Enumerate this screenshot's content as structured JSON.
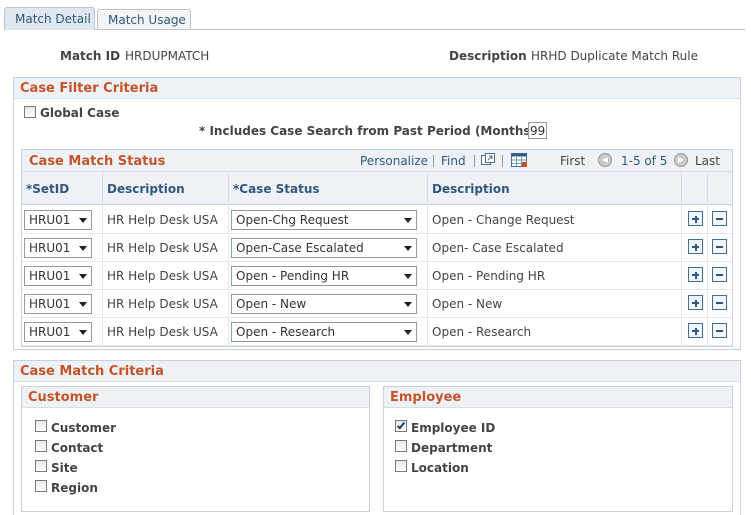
{
  "tabs": [
    {
      "label": "Match Detail"
    },
    {
      "label": "Match Usage"
    }
  ],
  "header": {
    "match_id_label": "Match ID",
    "match_id_value": "HRDUPMATCH",
    "description_label": "Description",
    "description_value": "HRHD Duplicate Match Rule"
  },
  "case_filter": {
    "title": "Case Filter Criteria",
    "global_case_label": "Global Case",
    "global_case_checked": false,
    "past_period_label": "* Includes Case Search from Past Period (Months)",
    "past_period_value": "99"
  },
  "grid": {
    "title": "Case Match Status",
    "personalize": "Personalize",
    "find": "Find",
    "first": "First",
    "range": "1-5 of 5",
    "last": "Last",
    "columns": [
      "*SetID",
      "Description",
      "*Case Status",
      "Description"
    ],
    "rows": [
      {
        "setid": "HRU01",
        "description": "HR Help Desk USA",
        "status": "Open-Chg Request",
        "status_desc": "Open - Change Request"
      },
      {
        "setid": "HRU01",
        "description": "HR Help Desk USA",
        "status": "Open-Case Escalated",
        "status_desc": "Open- Case Escalated"
      },
      {
        "setid": "HRU01",
        "description": "HR Help Desk USA",
        "status": "Open - Pending HR",
        "status_desc": "Open - Pending HR"
      },
      {
        "setid": "HRU01",
        "description": "HR Help Desk USA",
        "status": "Open - New",
        "status_desc": "Open - New"
      },
      {
        "setid": "HRU01",
        "description": "HR Help Desk USA",
        "status": "Open - Research",
        "status_desc": "Open - Research"
      }
    ]
  },
  "match_criteria": {
    "title": "Case Match Criteria",
    "customer": {
      "title": "Customer",
      "items": [
        {
          "label": "Customer",
          "checked": false
        },
        {
          "label": "Contact",
          "checked": false
        },
        {
          "label": "Site",
          "checked": false
        },
        {
          "label": "Region",
          "checked": false
        }
      ]
    },
    "employee": {
      "title": "Employee",
      "items": [
        {
          "label": "Employee ID",
          "checked": true
        },
        {
          "label": "Department",
          "checked": false
        },
        {
          "label": "Location",
          "checked": false
        }
      ]
    }
  },
  "colors": {
    "section_title": "#c4542a",
    "link": "#34577b",
    "header_bg": "#eef2f6"
  }
}
